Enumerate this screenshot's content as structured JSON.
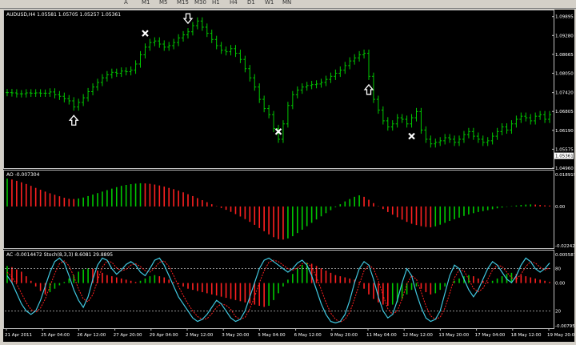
{
  "toolbar": {
    "labels": [
      "A",
      "M1",
      "M5",
      "M15",
      "M30",
      "H1",
      "H4",
      "D1",
      "W1",
      "MN"
    ]
  },
  "main_panel": {
    "header": "AUDUSD,H4  1.05581 1.05705 1.05257 1.05361",
    "price_labels": [
      "1.09895",
      "1.09280",
      "1.08665",
      "1.08050",
      "1.07420",
      "1.06805",
      "1.06190",
      "1.05575",
      "1.05361",
      "1.04960"
    ],
    "current_price": "1.05361"
  },
  "ao_panel": {
    "header": "AO -0.007304",
    "scale_labels": [
      "0.018919",
      "0.00",
      "-0.022424"
    ]
  },
  "ac_panel": {
    "header": "AC -0.0014472  Stoch(8,3,3) 8.6081 29.8895",
    "scale_labels": [
      "0.005587",
      "80",
      "0.00",
      "20",
      "-0.007952"
    ]
  },
  "time_labels": [
    "21 Apr 2011",
    "25 Apr 04:00",
    "26 Apr 12:00",
    "27 Apr 20:00",
    "29 Apr 04:00",
    "2 May 12:00",
    "3 May 20:00",
    "5 May 04:00",
    "6 May 12:00",
    "9 May 20:00",
    "11 May 04:00",
    "12 May 12:00",
    "13 May 20:00",
    "17 May 04:00",
    "18 May 12:00",
    "19 May 20:00"
  ],
  "colors": {
    "background": "#000000",
    "up_bar": "#00c800",
    "down_bar": "#ff2020",
    "stoch_main": "#40c8e0",
    "stoch_signal": "#ff2020",
    "panel_border": "#c0c0c0",
    "arrow": "#ffffff"
  },
  "chart_data": {
    "type": "bar",
    "price": [
      1.0742,
      1.0741,
      1.0738,
      1.0738,
      1.0741,
      1.074,
      1.0741,
      1.074,
      1.074,
      1.0744,
      1.0735,
      1.073,
      1.0722,
      1.0715,
      1.0695,
      1.071,
      1.0725,
      1.0745,
      1.076,
      1.0775,
      1.079,
      1.08,
      1.0808,
      1.0805,
      1.0812,
      1.081,
      1.0815,
      1.0835,
      1.0865,
      1.089,
      1.0905,
      1.091,
      1.09,
      1.089,
      1.0895,
      1.0905,
      1.092,
      1.093,
      1.094,
      1.096,
      1.0975,
      1.0955,
      1.0935,
      1.0915,
      1.0895,
      1.088,
      1.0875,
      1.0885,
      1.087,
      1.085,
      1.082,
      1.079,
      1.076,
      1.072,
      1.069,
      1.067,
      1.0625,
      1.059,
      1.064,
      1.07,
      1.0735,
      1.075,
      1.076,
      1.0765,
      1.0768,
      1.077,
      1.0775,
      1.0785,
      1.0795,
      1.0805,
      1.0815,
      1.083,
      1.0845,
      1.0855,
      1.0865,
      1.087,
      1.0795,
      1.072,
      1.0685,
      1.065,
      1.063,
      1.064,
      1.066,
      1.0655,
      1.064,
      1.066,
      1.068,
      1.062,
      1.059,
      1.0575,
      1.058,
      1.0585,
      1.0595,
      1.059,
      1.058,
      1.059,
      1.0605,
      1.0615,
      1.06,
      1.059,
      1.058,
      1.0585,
      1.06,
      1.0615,
      1.063,
      1.062,
      1.064,
      1.0655,
      1.0665,
      1.066,
      1.065,
      1.0665,
      1.067,
      1.0655,
      1.067
    ],
    "ao": [
      0.015,
      0.0145,
      0.0138,
      0.013,
      0.0121,
      0.0111,
      0.01,
      0.009,
      0.008,
      0.0071,
      0.0063,
      0.0055,
      0.0047,
      0.0041,
      0.004,
      0.0043,
      0.0048,
      0.0056,
      0.0064,
      0.0072,
      0.008,
      0.0088,
      0.0096,
      0.0104,
      0.0111,
      0.0116,
      0.012,
      0.0123,
      0.0125,
      0.0124,
      0.0122,
      0.0118,
      0.0113,
      0.0107,
      0.01,
      0.0093,
      0.0085,
      0.0076,
      0.0066,
      0.0056,
      0.0045,
      0.0034,
      0.0023,
      0.0012,
      0.0002,
      -0.0008,
      -0.0018,
      -0.0029,
      -0.0041,
      -0.0054,
      -0.0068,
      -0.0083,
      -0.0099,
      -0.0116,
      -0.0133,
      -0.015,
      -0.0165,
      -0.0176,
      -0.0178,
      -0.0172,
      -0.016,
      -0.0143,
      -0.0125,
      -0.0106,
      -0.0088,
      -0.007,
      -0.0053,
      -0.0036,
      -0.002,
      -0.0004,
      0.0012,
      0.0027,
      0.004,
      0.0052,
      0.006,
      0.0052,
      0.0036,
      0.0018,
      0.0002,
      -0.0014,
      -0.003,
      -0.0044,
      -0.0058,
      -0.0071,
      -0.0083,
      -0.0093,
      -0.01,
      -0.0106,
      -0.011,
      -0.0112,
      -0.0107,
      -0.0098,
      -0.0088,
      -0.0078,
      -0.0069,
      -0.006,
      -0.0051,
      -0.0043,
      -0.0036,
      -0.003,
      -0.0025,
      -0.002,
      -0.0015,
      -0.001,
      -0.0006,
      -0.0002,
      0.0002,
      0.0005,
      0.0008,
      0.001,
      0.0011,
      0.001,
      0.0008,
      0.0006,
      0.0005
    ],
    "ac": [
      0.003,
      0.0028,
      0.0024,
      0.002,
      0.0012,
      0.0004,
      -0.0006,
      -0.0014,
      -0.002,
      -0.0016,
      -0.001,
      -0.0004,
      0.0002,
      0.0008,
      0.0014,
      0.002,
      0.0024,
      0.0026,
      0.0025,
      0.0022,
      0.0018,
      0.0014,
      0.0012,
      0.001,
      0.0008,
      0.0006,
      0.0004,
      0.0002,
      0.0004,
      0.0008,
      0.0012,
      0.0014,
      0.0012,
      0.001,
      0.0006,
      0.0002,
      -0.0002,
      -0.0006,
      -0.001,
      -0.0012,
      -0.0014,
      -0.0016,
      -0.0018,
      -0.002,
      -0.0022,
      -0.0024,
      -0.0026,
      -0.0028,
      -0.003,
      -0.0032,
      -0.0034,
      -0.0036,
      -0.0038,
      -0.004,
      -0.0042,
      -0.004,
      -0.003,
      -0.0018,
      -0.0006,
      0.0006,
      0.0016,
      0.0026,
      0.0032,
      0.0036,
      0.0034,
      0.003,
      0.0026,
      0.0022,
      0.0018,
      0.0014,
      0.0012,
      0.001,
      0.0008,
      0.0006,
      0.0002,
      -0.001,
      -0.002,
      -0.0028,
      -0.0034,
      -0.0038,
      -0.004,
      -0.0038,
      -0.0034,
      -0.0028,
      -0.002,
      -0.0012,
      -0.0006,
      -0.001,
      -0.0016,
      -0.002,
      -0.0018,
      -0.0012,
      -0.0006,
      0.0,
      0.0004,
      0.0008,
      0.0012,
      0.0014,
      0.0012,
      0.0008,
      0.0004,
      0.0002,
      0.0004,
      0.0008,
      0.0012,
      0.0016,
      0.0018,
      0.0016,
      0.0014,
      0.0012,
      0.001,
      0.0008,
      0.0006,
      0.0004,
      0.0002
    ],
    "stoch_main": [
      70,
      60,
      45,
      30,
      20,
      15,
      20,
      35,
      55,
      75,
      90,
      95,
      88,
      70,
      50,
      35,
      25,
      40,
      65,
      85,
      95,
      92,
      80,
      72,
      78,
      86,
      90,
      85,
      75,
      70,
      80,
      92,
      95,
      85,
      70,
      55,
      40,
      30,
      20,
      10,
      5,
      8,
      15,
      25,
      35,
      30,
      20,
      10,
      5,
      8,
      20,
      40,
      60,
      80,
      92,
      95,
      90,
      85,
      80,
      75,
      80,
      88,
      92,
      85,
      70,
      50,
      30,
      15,
      5,
      3,
      5,
      15,
      35,
      60,
      80,
      90,
      85,
      65,
      40,
      20,
      10,
      15,
      35,
      60,
      80,
      70,
      45,
      25,
      10,
      5,
      8,
      20,
      45,
      70,
      85,
      80,
      65,
      50,
      40,
      50,
      65,
      80,
      90,
      85,
      75,
      65,
      60,
      70,
      85,
      95,
      90,
      80,
      75,
      80,
      88
    ],
    "stoch_signal": [
      75,
      68,
      58,
      45,
      32,
      22,
      18,
      24,
      37,
      55,
      73,
      87,
      91,
      84,
      69,
      51,
      37,
      33,
      43,
      63,
      82,
      91,
      89,
      81,
      77,
      79,
      85,
      87,
      83,
      77,
      75,
      81,
      89,
      91,
      83,
      70,
      55,
      42,
      30,
      20,
      12,
      8,
      9,
      16,
      25,
      30,
      28,
      22,
      12,
      8,
      11,
      23,
      40,
      60,
      77,
      89,
      92,
      90,
      85,
      80,
      78,
      81,
      87,
      88,
      82,
      68,
      50,
      32,
      17,
      8,
      4,
      8,
      18,
      37,
      58,
      77,
      85,
      80,
      63,
      42,
      23,
      15,
      20,
      37,
      58,
      70,
      65,
      47,
      27,
      13,
      8,
      11,
      24,
      45,
      67,
      78,
      77,
      65,
      52,
      47,
      52,
      65,
      78,
      85,
      83,
      75,
      67,
      65,
      72,
      83,
      90,
      88,
      82,
      78,
      81
    ],
    "price_range": [
      1.0496,
      1.1007
    ],
    "ao_range": [
      -0.022424,
      0.018919
    ],
    "ac_range": [
      -0.007952,
      0.005587
    ],
    "stoch_levels": [
      80,
      20
    ],
    "up_arrows": [
      14,
      76
    ],
    "down_arrows": [
      38
    ],
    "exit_marks": [
      {
        "bar": 29,
        "price": 1.0935
      },
      {
        "bar": 57,
        "price": 1.0615
      },
      {
        "bar": 85,
        "price": 1.06
      }
    ]
  }
}
